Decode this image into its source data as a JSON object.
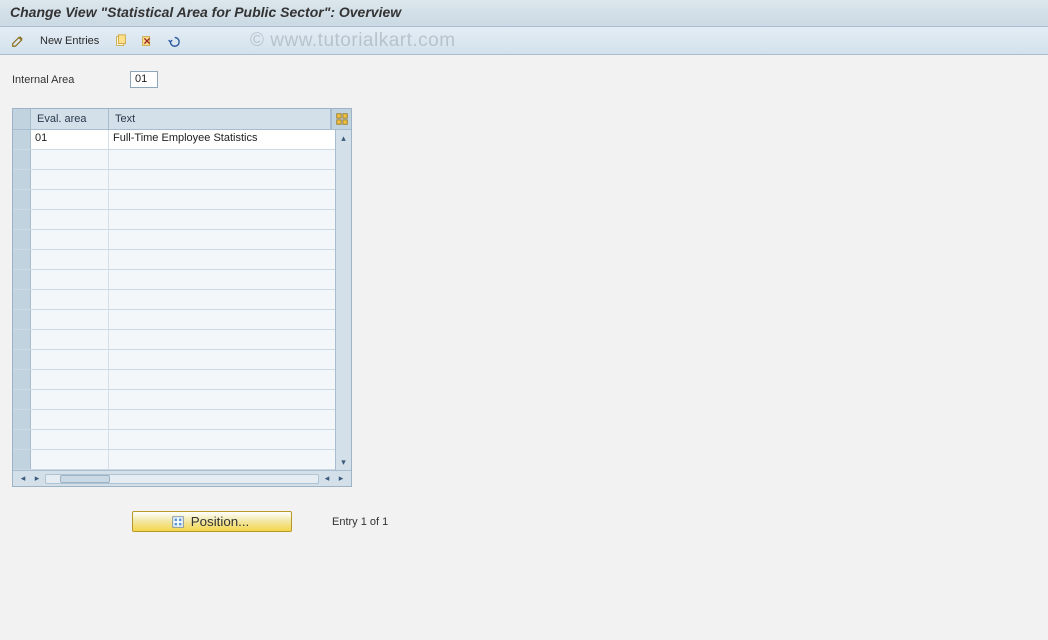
{
  "title": "Change View \"Statistical Area for Public Sector\": Overview",
  "watermark": "© www.tutorialkart.com",
  "toolbar": {
    "new_entries": "New Entries"
  },
  "field": {
    "internal_area_label": "Internal Area",
    "internal_area_value": "01"
  },
  "table": {
    "col_eval_area": "Eval. area",
    "col_text": "Text",
    "rows": [
      {
        "eval": "01",
        "text": "Full-Time Employee Statistics"
      }
    ],
    "empty_row_count": 16
  },
  "footer": {
    "position_button": "Position...",
    "entry_info": "Entry 1 of 1"
  }
}
